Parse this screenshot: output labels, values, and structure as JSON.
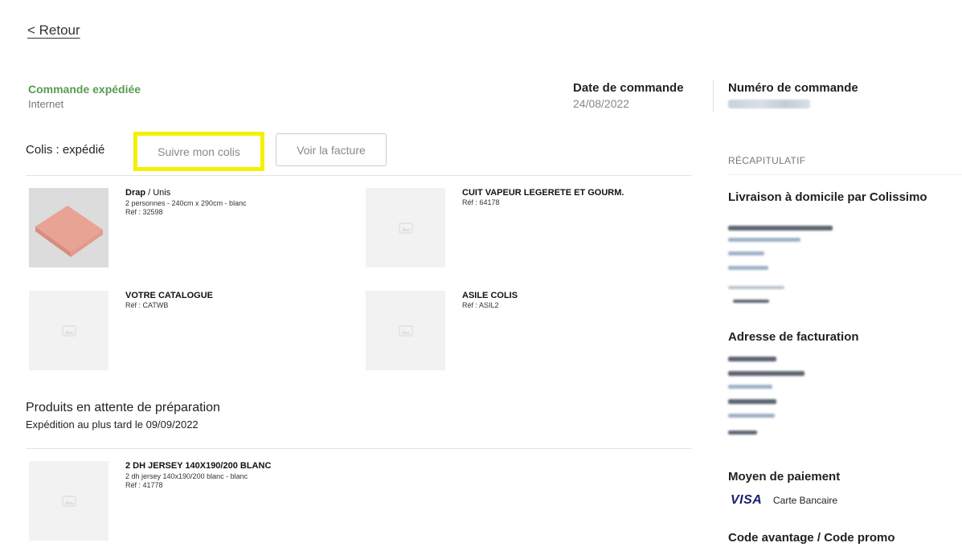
{
  "nav": {
    "back_label": "< Retour"
  },
  "order": {
    "status": "Commande expédiée",
    "channel": "Internet",
    "date_label": "Date de commande",
    "date_value": "24/08/2022",
    "number_label": "Numéro de commande"
  },
  "shipment": {
    "colis_label": "Colis : expédié",
    "track_button": "Suivre mon colis",
    "invoice_button": "Voir la facture",
    "highlight_color": "#f5f000"
  },
  "shipped_products": [
    {
      "name": "Drap",
      "variant": "/ Unis",
      "desc": "2 personnes - 240cm x 290cm - blanc",
      "ref": "Réf : 32598",
      "image": "pink-sheet"
    },
    {
      "name": "CUIT VAPEUR LEGERETE ET GOURM.",
      "variant": "",
      "desc": "",
      "ref": "Réf : 64178",
      "image": "placeholder-image-icon"
    },
    {
      "name": "VOTRE CATALOGUE",
      "variant": "",
      "desc": "",
      "ref": "Réf : CATWB",
      "image": "placeholder-image-icon"
    },
    {
      "name": "ASILE COLIS",
      "variant": "",
      "desc": "",
      "ref": "Réf : ASIL2",
      "image": "placeholder-image-icon"
    }
  ],
  "pending": {
    "title": "Produits en attente de préparation",
    "subtitle": "Expédition au plus tard le 09/09/2022",
    "products": [
      {
        "name": "2 DH JERSEY 140X190/200 BLANC",
        "desc": "2 dh jersey 140x190/200 blanc - blanc",
        "ref": "Réf : 41778",
        "image": "placeholder-image-icon"
      }
    ]
  },
  "summary": {
    "title": "RÉCAPITULATIF",
    "delivery_heading": "Livraison à domicile par Colissimo",
    "billing_heading": "Adresse de facturation",
    "payment_heading": "Moyen de paiement",
    "payment_brand": "VISA",
    "payment_label": "Carte Bancaire",
    "promo_heading": "Code avantage / Code promo"
  },
  "colors": {
    "status_green": "#5a9a55",
    "visa_blue": "#1a1f71"
  }
}
